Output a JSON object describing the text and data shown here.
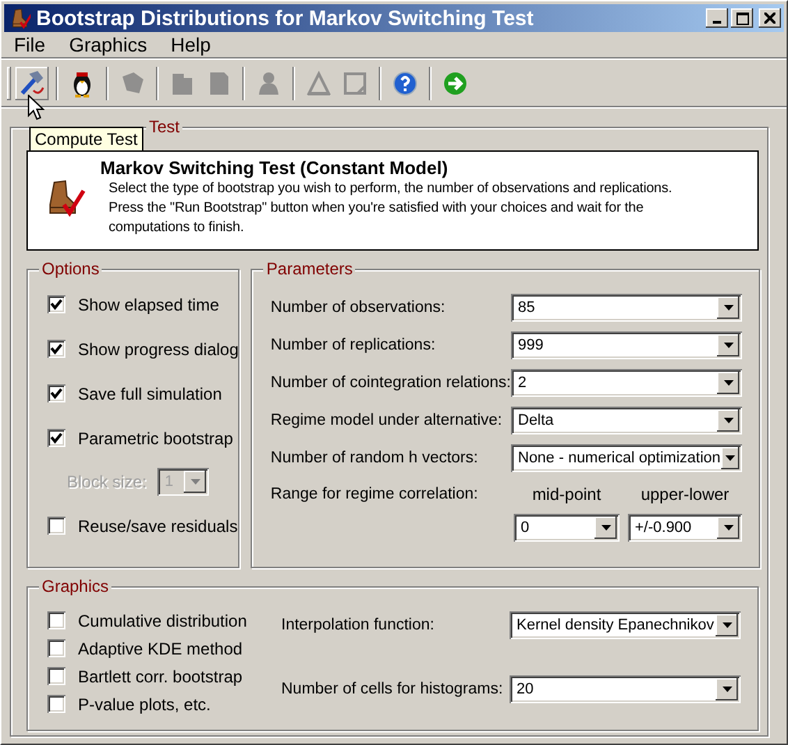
{
  "window": {
    "title": "Bootstrap Distributions for Markov Switching Test"
  },
  "menu": [
    {
      "label": "File"
    },
    {
      "label": "Graphics"
    },
    {
      "label": "Help"
    }
  ],
  "toolbar": {
    "groups": [
      [
        {
          "disabled": false,
          "hovered": true
        }
      ],
      [
        {
          "disabled": false,
          "hovered": false
        }
      ],
      [
        {
          "disabled": true,
          "hovered": false
        }
      ],
      [
        {
          "disabled": true,
          "hovered": false
        },
        {
          "disabled": true,
          "hovered": false
        }
      ],
      [
        {
          "disabled": true,
          "hovered": false
        }
      ],
      [
        {
          "disabled": true,
          "hovered": false
        },
        {
          "disabled": true,
          "hovered": false
        }
      ],
      [
        {
          "disabled": false,
          "hovered": false
        }
      ],
      [
        {
          "disabled": false,
          "hovered": false
        }
      ]
    ]
  },
  "tooltip": "Compute Test",
  "main_group": {
    "title": "Test",
    "header": {
      "title": "Markov Switching Test (Constant Model)",
      "lines": [
        "Select the type of bootstrap you wish to perform, the number of observations and replications.",
        "Press the \"Run Bootstrap\" button when you're satisfied with your choices and wait for the",
        "computations to finish."
      ]
    },
    "options": {
      "title": "Options",
      "items": [
        {
          "kind": "checkbox",
          "label": "Show elapsed time",
          "checked": true
        },
        {
          "kind": "checkbox",
          "label": "Show progress dialog",
          "checked": true
        },
        {
          "kind": "checkbox",
          "label": "Save full simulation",
          "checked": true
        },
        {
          "kind": "checkbox",
          "label": "Parametric bootstrap",
          "checked": true
        },
        {
          "kind": "dropdown",
          "label": "Block size:",
          "value": "1",
          "disabled": true
        },
        {
          "kind": "checkbox",
          "label": "Reuse/save residuals",
          "checked": false
        }
      ]
    },
    "parameters": {
      "title": "Parameters",
      "rows": [
        {
          "kind": "dropdown",
          "label": "Number of observations:",
          "value": "85"
        },
        {
          "kind": "dropdown",
          "label": "Number of replications:",
          "value": "999"
        },
        {
          "kind": "dropdown",
          "label": "Number of cointegration relations:",
          "value": "2"
        },
        {
          "kind": "dropdown",
          "label": "Regime model under alternative:",
          "value": "Delta"
        },
        {
          "kind": "dropdown",
          "label": "Number of random h vectors:",
          "value": "None - numerical optimization"
        },
        {
          "kind": "pair",
          "label": "Range for regime correlation:",
          "fields": [
            {
              "caption": "mid-point",
              "value": "0"
            },
            {
              "caption": "upper-lower",
              "value": "+/-0.900"
            }
          ]
        }
      ]
    },
    "graphics": {
      "title": "Graphics",
      "checkboxes": [
        {
          "label": "Cumulative distribution",
          "checked": false
        },
        {
          "label": "Adaptive KDE method",
          "checked": false
        },
        {
          "label": "Bartlett corr. bootstrap",
          "checked": false
        },
        {
          "label": "P-value plots, etc.",
          "checked": false
        }
      ],
      "rows": [
        {
          "label": "Interpolation function:",
          "value": "Kernel density Epanechnikov"
        },
        {
          "label": "Number of cells for histograms:",
          "value": "20"
        }
      ]
    }
  }
}
